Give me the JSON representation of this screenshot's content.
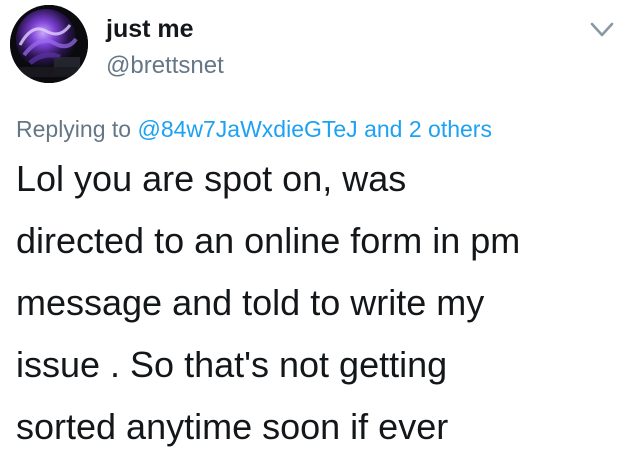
{
  "tweet": {
    "author": {
      "display_name": "just me",
      "handle": "@brettsnet",
      "avatar": "profile-photo-purple-abstract"
    },
    "menu_icon": "chevron-down-icon",
    "replying": {
      "prefix": "Replying to",
      "mention": "@84w7JaWxdieGTeJ",
      "conjunction": "and",
      "others": "2 others"
    },
    "text_lines": [
      "Lol you are spot on, was",
      "directed to an online form in pm",
      "message and told to write my",
      "issue . So that's not getting",
      "sorted anytime soon if ever"
    ]
  },
  "colors": {
    "text": "#14171a",
    "secondary_text": "#657786",
    "link": "#1da1f2",
    "background": "#ffffff"
  }
}
